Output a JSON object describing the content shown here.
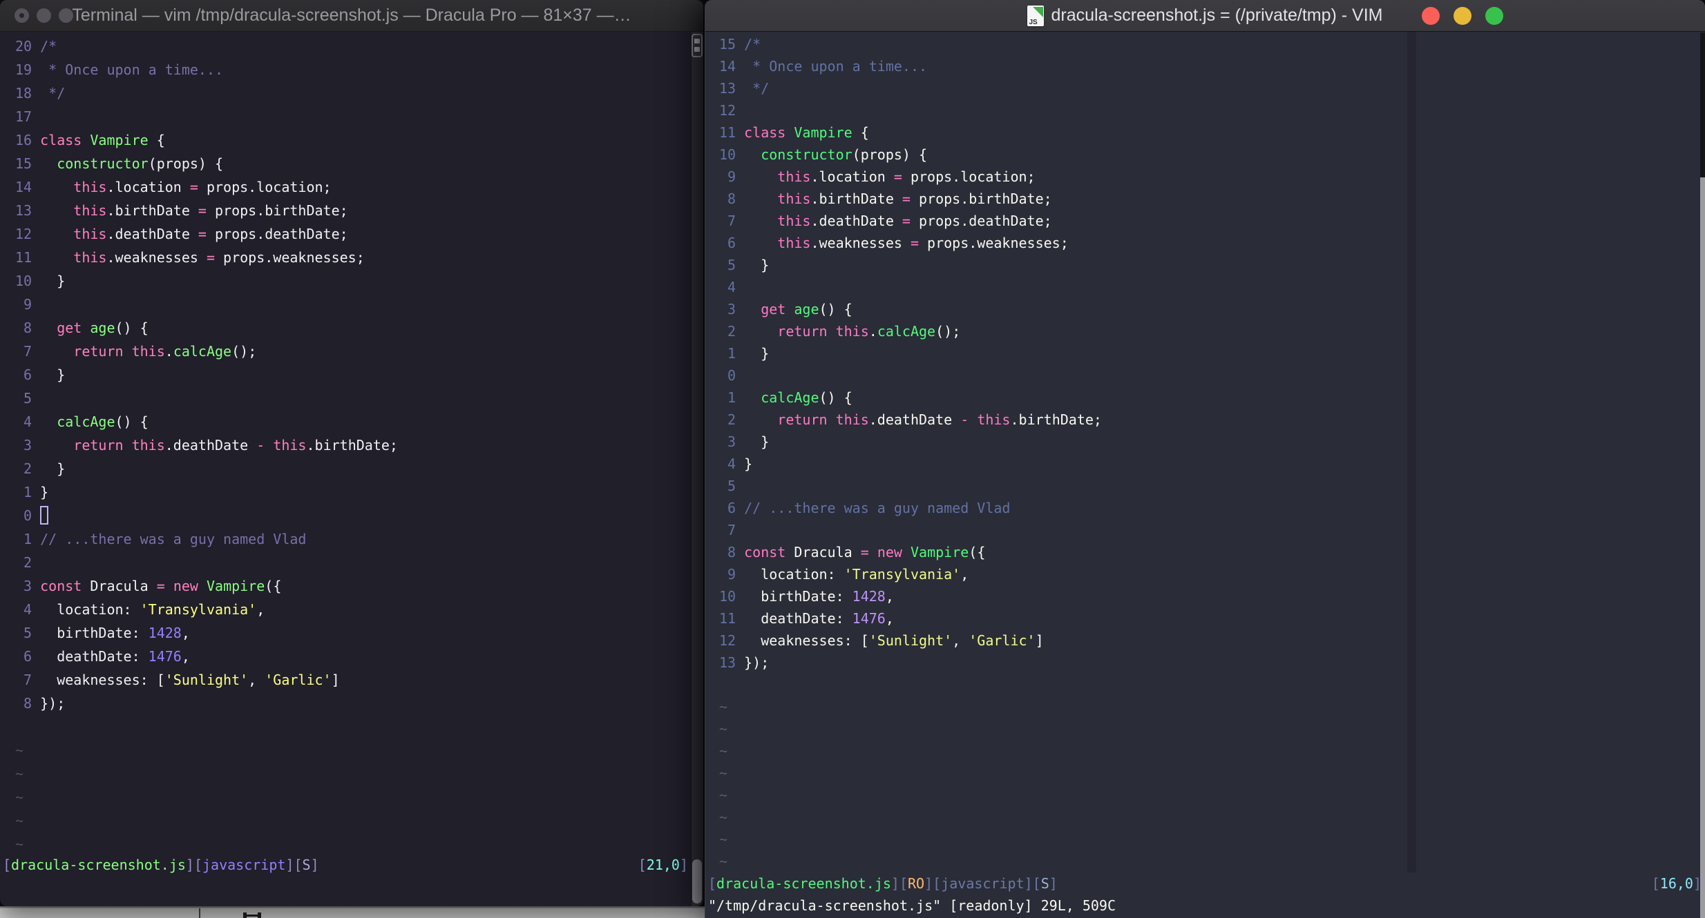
{
  "left_window": {
    "app": "Terminal",
    "title": "Terminal — vim /tmp/dracula-screenshot.js — Dracula Pro — 81×37 —…",
    "focused": false,
    "colors": {
      "background": "#201f2a",
      "foreground": "#F2F1F4",
      "comment": "#7970A9",
      "pink": "#FF80BF",
      "green": "#8AFF80",
      "yellow": "#FFFF80",
      "purple": "#9580FF",
      "cyan": "#80FFEA"
    },
    "line_numbers": [
      "20",
      "19",
      "18",
      "17",
      "16",
      "15",
      "14",
      "13",
      "12",
      "11",
      "10",
      " 9",
      " 8",
      " 7",
      " 6",
      " 5",
      " 4",
      " 3",
      " 2",
      " 1",
      " 0",
      " 1",
      " 2",
      " 3",
      " 4",
      " 5",
      " 6",
      " 7",
      " 8"
    ],
    "cursor_line_index": 20,
    "cursor_style": "hollow-block",
    "tilde_rows": 5,
    "statusline": {
      "left_segments": [
        [
          "br",
          "["
        ],
        [
          "gr",
          "dracula-screenshot.js"
        ],
        [
          "br",
          "]["
        ],
        [
          "js",
          "javascript"
        ],
        [
          "br",
          "]["
        ],
        [
          "s",
          "S"
        ],
        [
          "br",
          "]"
        ]
      ],
      "right_segments": [
        [
          "br",
          "["
        ],
        [
          "cy",
          "21,0"
        ],
        [
          "br",
          "]"
        ]
      ]
    }
  },
  "right_window": {
    "app": "VIM",
    "title": "dracula-screenshot.js = (/private/tmp) - VIM",
    "focused": true,
    "traffic_lights": [
      "close",
      "minimize",
      "zoom"
    ],
    "colors": {
      "background": "#2a2c37",
      "foreground": "#F8F8F2",
      "comment": "#6272A4",
      "pink": "#FF79C6",
      "green": "#50FA7B",
      "yellow": "#F1FA8C",
      "purple": "#BD93F9",
      "cyan": "#8BE9FD",
      "orange": "#FFB86C",
      "colorcolumn": "#242531"
    },
    "line_numbers": [
      "15",
      "14",
      "13",
      "12",
      "11",
      "10",
      " 9",
      " 8",
      " 7",
      " 6",
      " 5",
      " 4",
      " 3",
      " 2",
      " 1",
      " 0",
      " 1",
      " 2",
      " 3",
      " 4",
      " 5",
      " 6",
      " 7",
      " 8",
      " 9",
      "10",
      "11",
      "12",
      "13"
    ],
    "cursor_line_index": 15,
    "cursor_style": "hidden",
    "tilde_rows": 8,
    "statusline": {
      "left_segments": [
        [
          "br",
          "["
        ],
        [
          "gr",
          "dracula-screenshot.js"
        ],
        [
          "br",
          "]["
        ],
        [
          "or",
          "RO"
        ],
        [
          "br",
          "]["
        ],
        [
          "js",
          "javascript"
        ],
        [
          "br",
          "]["
        ],
        [
          "s",
          "S"
        ],
        [
          "br",
          "]"
        ]
      ],
      "right_segments": [
        [
          "br",
          "["
        ],
        [
          "cy",
          "16,0"
        ],
        [
          "br",
          "]"
        ]
      ]
    },
    "command_line": "\"/tmp/dracula-screenshot.js\" [readonly] 29L, 509C"
  },
  "code_lines": [
    [
      [
        "cm",
        "/*"
      ]
    ],
    [
      [
        "cm",
        " * Once upon a time..."
      ]
    ],
    [
      [
        "cm",
        " */"
      ]
    ],
    [],
    [
      [
        "pk",
        "class"
      ],
      [
        "fg",
        " "
      ],
      [
        "gr",
        "Vampire"
      ],
      [
        "fg",
        " {"
      ]
    ],
    [
      [
        "fg",
        "  "
      ],
      [
        "gr",
        "constructor"
      ],
      [
        "fg",
        "(props) {"
      ]
    ],
    [
      [
        "fg",
        "    "
      ],
      [
        "pk",
        "this"
      ],
      [
        "fg",
        ".location "
      ],
      [
        "pk",
        "="
      ],
      [
        "fg",
        " props.location;"
      ]
    ],
    [
      [
        "fg",
        "    "
      ],
      [
        "pk",
        "this"
      ],
      [
        "fg",
        ".birthDate "
      ],
      [
        "pk",
        "="
      ],
      [
        "fg",
        " props.birthDate;"
      ]
    ],
    [
      [
        "fg",
        "    "
      ],
      [
        "pk",
        "this"
      ],
      [
        "fg",
        ".deathDate "
      ],
      [
        "pk",
        "="
      ],
      [
        "fg",
        " props.deathDate;"
      ]
    ],
    [
      [
        "fg",
        "    "
      ],
      [
        "pk",
        "this"
      ],
      [
        "fg",
        ".weaknesses "
      ],
      [
        "pk",
        "="
      ],
      [
        "fg",
        " props.weaknesses;"
      ]
    ],
    [
      [
        "fg",
        "  }"
      ]
    ],
    [],
    [
      [
        "fg",
        "  "
      ],
      [
        "pk",
        "get"
      ],
      [
        "fg",
        " "
      ],
      [
        "gr",
        "age"
      ],
      [
        "fg",
        "() {"
      ]
    ],
    [
      [
        "fg",
        "    "
      ],
      [
        "pk",
        "return"
      ],
      [
        "fg",
        " "
      ],
      [
        "pk",
        "this"
      ],
      [
        "fg",
        "."
      ],
      [
        "gr",
        "calcAge"
      ],
      [
        "fg",
        "();"
      ]
    ],
    [
      [
        "fg",
        "  }"
      ]
    ],
    [],
    [
      [
        "fg",
        "  "
      ],
      [
        "gr",
        "calcAge"
      ],
      [
        "fg",
        "() {"
      ]
    ],
    [
      [
        "fg",
        "    "
      ],
      [
        "pk",
        "return"
      ],
      [
        "fg",
        " "
      ],
      [
        "pk",
        "this"
      ],
      [
        "fg",
        ".deathDate "
      ],
      [
        "pk",
        "-"
      ],
      [
        "fg",
        " "
      ],
      [
        "pk",
        "this"
      ],
      [
        "fg",
        ".birthDate;"
      ]
    ],
    [
      [
        "fg",
        "  }"
      ]
    ],
    [
      [
        "fg",
        "}"
      ]
    ],
    [],
    [
      [
        "cm",
        "// ...there was a guy named Vlad"
      ]
    ],
    [],
    [
      [
        "pk",
        "const"
      ],
      [
        "fg",
        " Dracula "
      ],
      [
        "pk",
        "="
      ],
      [
        "fg",
        " "
      ],
      [
        "pk",
        "new"
      ],
      [
        "fg",
        " "
      ],
      [
        "gr",
        "Vampire"
      ],
      [
        "fg",
        "({"
      ]
    ],
    [
      [
        "fg",
        "  location: "
      ],
      [
        "yl",
        "'Transylvania'"
      ],
      [
        "fg",
        ","
      ]
    ],
    [
      [
        "fg",
        "  birthDate: "
      ],
      [
        "pu",
        "1428"
      ],
      [
        "fg",
        ","
      ]
    ],
    [
      [
        "fg",
        "  deathDate: "
      ],
      [
        "pu",
        "1476"
      ],
      [
        "fg",
        ","
      ]
    ],
    [
      [
        "fg",
        "  weaknesses: ["
      ],
      [
        "yl",
        "'Sunlight'"
      ],
      [
        "fg",
        ", "
      ],
      [
        "yl",
        "'Garlic'"
      ],
      [
        "fg",
        "]"
      ]
    ],
    [
      [
        "fg",
        "});"
      ]
    ]
  ]
}
